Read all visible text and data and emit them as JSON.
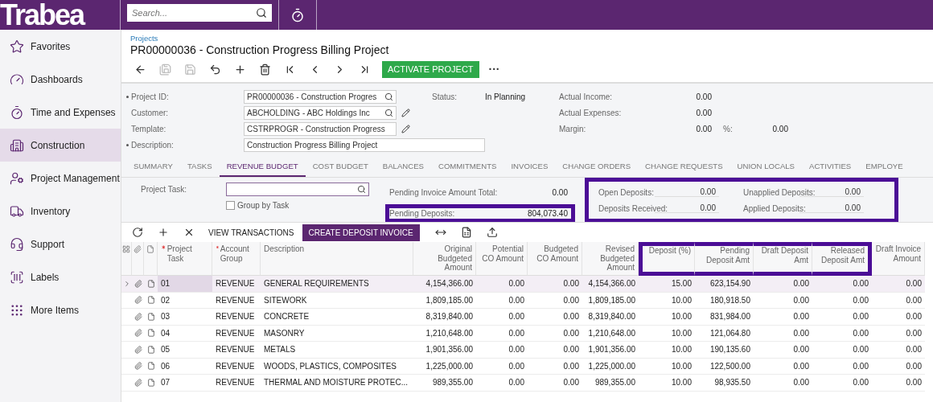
{
  "header": {
    "logo": "Trabea",
    "search": {
      "placeholder": "Search..."
    }
  },
  "sidebar": {
    "items": [
      {
        "label": "Favorites",
        "selected": false
      },
      {
        "label": "Dashboards",
        "selected": false
      },
      {
        "label": "Time and Expenses",
        "selected": false
      },
      {
        "label": "Construction",
        "selected": true
      },
      {
        "label": "Project Management",
        "selected": false
      },
      {
        "label": "Inventory",
        "selected": false
      },
      {
        "label": "Support",
        "selected": false
      },
      {
        "label": "Labels",
        "selected": false
      },
      {
        "label": "More Items",
        "selected": false
      }
    ]
  },
  "breadcrumb": "Projects",
  "title": "PR00000036 - Construction Progress Billing Project",
  "toolbar": [
    {
      "kind": "icon",
      "disabled": false
    },
    {
      "kind": "icon",
      "disabled": true
    },
    {
      "kind": "icon",
      "disabled": true
    },
    {
      "kind": "icon",
      "disabled": false
    },
    {
      "kind": "icon",
      "disabled": false
    },
    {
      "kind": "icon",
      "disabled": false
    },
    {
      "kind": "icon",
      "disabled": false
    },
    {
      "kind": "icon",
      "disabled": false
    },
    {
      "kind": "icon",
      "disabled": false
    },
    {
      "kind": "icon",
      "disabled": false
    },
    {
      "kind": "button",
      "label": "ACTIVATE PROJECT"
    },
    {
      "kind": "more",
      "label": "···"
    }
  ],
  "form": {
    "fields": [
      {
        "label": "Project ID:",
        "value": "PR00000036 - Construction Progres",
        "required": true,
        "search": true,
        "edit": false
      },
      {
        "label": "Customer:",
        "value": "ABCHOLDING - ABC Holdings Inc",
        "required": false,
        "search": true,
        "edit": true
      },
      {
        "label": "Template:",
        "value": "CSTRPROGR - Construction Progress",
        "required": false,
        "search": false,
        "edit": true
      },
      {
        "label": "Description:",
        "value": "Construction Progress Billing Project",
        "required": true,
        "search": false,
        "edit": false
      }
    ],
    "status": {
      "label": "Status:",
      "value": "In Planning"
    },
    "totals": [
      {
        "label": "Actual Income:",
        "value": "0.00"
      },
      {
        "label": "Actual Expenses:",
        "value": "0.00"
      },
      {
        "label": "Margin:",
        "value": "0.00"
      }
    ],
    "margin_percent": {
      "label": "%:",
      "value": "0.00"
    }
  },
  "tabs": [
    {
      "label": "SUMMARY",
      "selected": false
    },
    {
      "label": "TASKS",
      "selected": false
    },
    {
      "label": "REVENUE BUDGET",
      "selected": true
    },
    {
      "label": "COST BUDGET",
      "selected": false
    },
    {
      "label": "BALANCES",
      "selected": false
    },
    {
      "label": "COMMITMENTS",
      "selected": false
    },
    {
      "label": "INVOICES",
      "selected": false
    },
    {
      "label": "CHANGE ORDERS",
      "selected": false
    },
    {
      "label": "CHANGE REQUESTS",
      "selected": false
    },
    {
      "label": "UNION LOCALS",
      "selected": false
    },
    {
      "label": "ACTIVITIES",
      "selected": false
    },
    {
      "label": "EMPLOYE",
      "selected": false
    }
  ],
  "filter": {
    "label": "Project Task:",
    "group_by_task": {
      "label": "Group by Task",
      "checked": false
    }
  },
  "pending": [
    {
      "label": "Pending Invoice Amount Total:",
      "value": "0.00",
      "highlighted": false
    },
    {
      "label": "Pending Deposits:",
      "value": "804,073.40",
      "highlighted": true
    }
  ],
  "deposits": {
    "highlighted": true,
    "items": [
      {
        "label": "Open Deposits:",
        "value": "0.00"
      },
      {
        "label": "Unapplied Deposits:",
        "value": "0.00"
      },
      {
        "label": "Deposits Received:",
        "value": "0.00"
      },
      {
        "label": "Applied Deposits:",
        "value": "0.00"
      }
    ]
  },
  "grid_toolbar": [
    {
      "kind": "icon"
    },
    {
      "kind": "icon"
    },
    {
      "kind": "icon"
    },
    {
      "kind": "text",
      "label": "VIEW TRANSACTIONS"
    },
    {
      "kind": "primary",
      "label": "CREATE DEPOSIT INVOICE"
    },
    {
      "kind": "icon"
    },
    {
      "kind": "icon"
    },
    {
      "kind": "icon"
    }
  ],
  "table": {
    "columns": [
      {
        "label": "Project Task",
        "required": true,
        "highlighted": false
      },
      {
        "label": "Account Group",
        "required": true,
        "highlighted": false
      },
      {
        "label": "Description",
        "required": false,
        "highlighted": false
      },
      {
        "label": "Original Budgeted Amount",
        "required": false,
        "highlighted": false
      },
      {
        "label": "Potential CO Amount",
        "required": false,
        "highlighted": false
      },
      {
        "label": "Budgeted CO Amount",
        "required": false,
        "highlighted": false
      },
      {
        "label": "Revised Budgeted Amount",
        "required": false,
        "highlighted": false
      },
      {
        "label": "Deposit (%)",
        "required": false,
        "highlighted": true
      },
      {
        "label": "Pending Deposit Amt",
        "required": false,
        "highlighted": true
      },
      {
        "label": "Draft Deposit Amt",
        "required": false,
        "highlighted": true
      },
      {
        "label": "Released Deposit Amt",
        "required": false,
        "highlighted": true
      },
      {
        "label": "Draft Invoice Amount",
        "required": false,
        "highlighted": false
      }
    ],
    "rows": [
      {
        "selected": true,
        "cells": [
          "01",
          "REVENUE",
          "GENERAL REQUIREMENTS",
          "4,154,366.00",
          "0.00",
          "0.00",
          "4,154,366.00",
          "15.00",
          "623,154.90",
          "0.00",
          "0.00",
          "0.00"
        ]
      },
      {
        "selected": false,
        "cells": [
          "02",
          "REVENUE",
          "SITEWORK",
          "1,809,185.00",
          "0.00",
          "0.00",
          "1,809,185.00",
          "10.00",
          "180,918.50",
          "0.00",
          "0.00",
          "0.00"
        ]
      },
      {
        "selected": false,
        "cells": [
          "03",
          "REVENUE",
          "CONCRETE",
          "8,319,840.00",
          "0.00",
          "0.00",
          "8,319,840.00",
          "10.00",
          "831,984.00",
          "0.00",
          "0.00",
          "0.00"
        ]
      },
      {
        "selected": false,
        "cells": [
          "04",
          "REVENUE",
          "MASONRY",
          "1,210,648.00",
          "0.00",
          "0.00",
          "1,210,648.00",
          "10.00",
          "121,064.80",
          "0.00",
          "0.00",
          "0.00"
        ]
      },
      {
        "selected": false,
        "cells": [
          "05",
          "REVENUE",
          "METALS",
          "1,901,356.00",
          "0.00",
          "0.00",
          "1,901,356.00",
          "10.00",
          "190,135.60",
          "0.00",
          "0.00",
          "0.00"
        ]
      },
      {
        "selected": false,
        "cells": [
          "06",
          "REVENUE",
          "WOODS, PLASTICS, COMPOSITES",
          "1,225,000.00",
          "0.00",
          "0.00",
          "1,225,000.00",
          "10.00",
          "122,500.00",
          "0.00",
          "0.00",
          "0.00"
        ]
      },
      {
        "selected": false,
        "cells": [
          "07",
          "REVENUE",
          "THERMAL AND MOISTURE PROTEC...",
          "989,355.00",
          "0.00",
          "0.00",
          "989,355.00",
          "10.00",
          "98,935.50",
          "0.00",
          "0.00",
          "0.00"
        ]
      }
    ]
  }
}
